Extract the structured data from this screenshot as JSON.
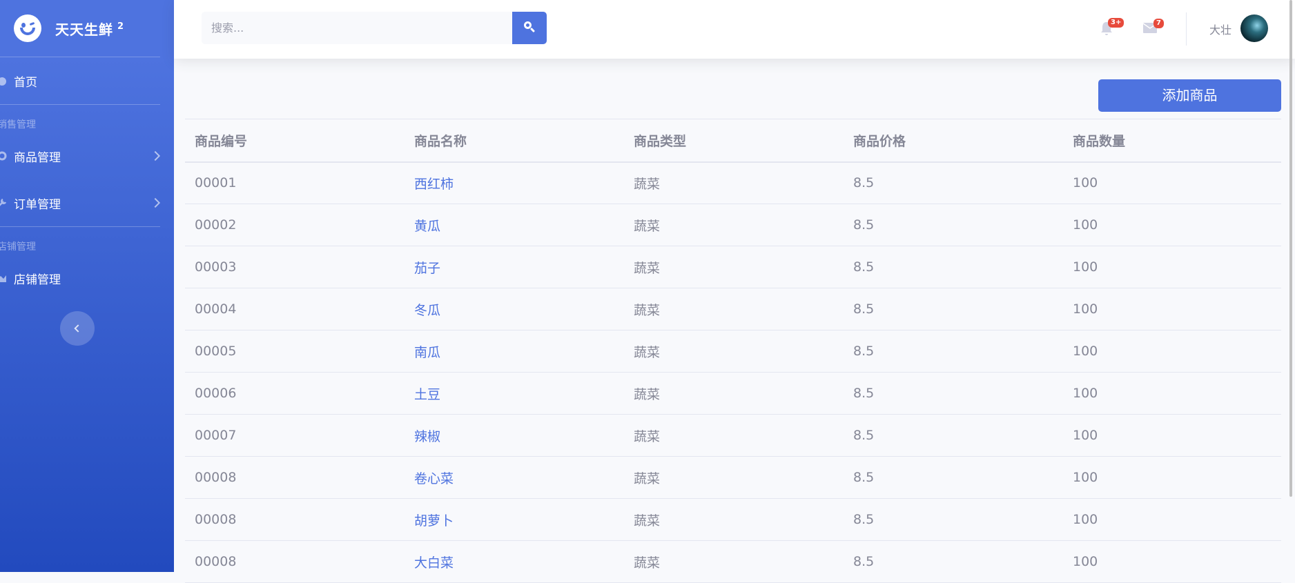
{
  "brand": {
    "name": "天天生鲜",
    "sup": "2"
  },
  "sidebar": {
    "home_label": "首页",
    "heading_sales": "销售管理",
    "items": [
      {
        "label": "商品管理"
      },
      {
        "label": "订单管理"
      }
    ],
    "heading_store": "店铺管理",
    "store_label": "店铺管理"
  },
  "search": {
    "placeholder": "搜索..."
  },
  "notifications": {
    "alerts_badge": "3+",
    "messages_badge": "7"
  },
  "user": {
    "name": "大壮"
  },
  "main": {
    "add_button": "添加商品"
  },
  "table": {
    "headers": [
      "商品编号",
      "商品名称",
      "商品类型",
      "商品价格",
      "商品数量"
    ],
    "rows": [
      [
        "00001",
        "西红柿",
        "蔬菜",
        "8.5",
        "100"
      ],
      [
        "00002",
        "黄瓜",
        "蔬菜",
        "8.5",
        "100"
      ],
      [
        "00003",
        "茄子",
        "蔬菜",
        "8.5",
        "100"
      ],
      [
        "00004",
        "冬瓜",
        "蔬菜",
        "8.5",
        "100"
      ],
      [
        "00005",
        "南瓜",
        "蔬菜",
        "8.5",
        "100"
      ],
      [
        "00006",
        "土豆",
        "蔬菜",
        "8.5",
        "100"
      ],
      [
        "00007",
        "辣椒",
        "蔬菜",
        "8.5",
        "100"
      ],
      [
        "00008",
        "卷心菜",
        "蔬菜",
        "8.5",
        "100"
      ],
      [
        "00008",
        "胡萝卜",
        "蔬菜",
        "8.5",
        "100"
      ],
      [
        "00008",
        "大白菜",
        "蔬菜",
        "8.5",
        "100"
      ]
    ]
  },
  "colors": {
    "primary": "#4e73df",
    "sidebar_end": "#224abe",
    "badge": "#e74a3b",
    "text": "#858796"
  }
}
